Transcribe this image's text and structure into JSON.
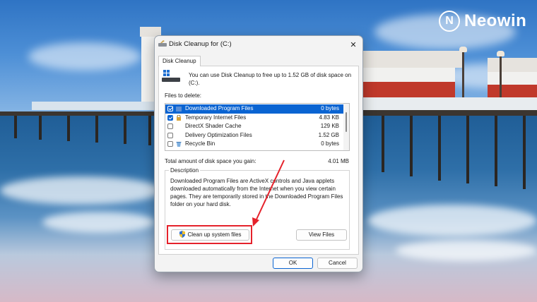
{
  "brand": {
    "logo_text": "Neowin",
    "logo_icon": "neowin-logo-icon"
  },
  "dialog": {
    "title": "Disk Cleanup for  (C:)",
    "title_icon": "disk-cleanup-icon",
    "close_icon": "close-icon",
    "tab_label": "Disk Cleanup",
    "intro_text": "You can use Disk Cleanup to free up to 1.52 GB of disk space on (C:).",
    "files_label": "Files to delete:",
    "files": [
      {
        "name": "Downloaded Program Files",
        "size": "0 bytes",
        "checked": true,
        "selected": true,
        "icon": "folder-icon"
      },
      {
        "name": "Temporary Internet Files",
        "size": "4.83 KB",
        "checked": true,
        "selected": false,
        "icon": "lock-icon"
      },
      {
        "name": "DirectX Shader Cache",
        "size": "129 KB",
        "checked": false,
        "selected": false,
        "icon": ""
      },
      {
        "name": "Delivery Optimization Files",
        "size": "1.52 GB",
        "checked": false,
        "selected": false,
        "icon": ""
      },
      {
        "name": "Recycle Bin",
        "size": "0 bytes",
        "checked": false,
        "selected": false,
        "icon": "recycle-bin-icon"
      }
    ],
    "total_label": "Total amount of disk space you gain:",
    "total_value": "4.01 MB",
    "description_title": "Description",
    "description_text": "Downloaded Program Files are ActiveX controls and Java applets downloaded automatically from the Internet when you view certain pages. They are temporarily stored in the Downloaded Program Files folder on your hard disk.",
    "cleanup_button": "Clean up system files",
    "view_files_button": "View Files",
    "ok_button": "OK",
    "cancel_button": "Cancel"
  },
  "colors": {
    "accent": "#0a64d2",
    "annotation": "#e5222b"
  }
}
